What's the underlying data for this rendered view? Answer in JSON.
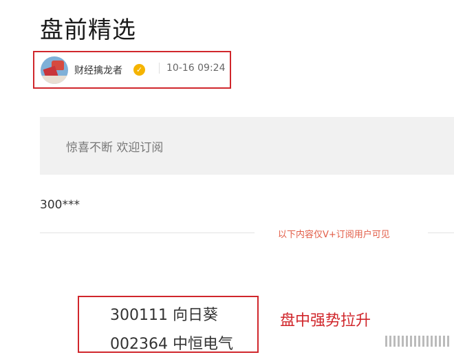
{
  "article": {
    "title": "盘前精选",
    "author": "财经擒龙者",
    "verified_icon": "check-badge-icon",
    "time": "10-16 09:24",
    "promo_text": "惊喜不断 欢迎订阅",
    "preview_code": "300***",
    "vip_notice": "以下内容仅V+订阅用户可见"
  },
  "stocks": [
    {
      "code": "300111",
      "name": "向日葵"
    },
    {
      "code": "002364",
      "name": "中恒电气"
    }
  ],
  "annotation": "盘中强势拉升",
  "colors": {
    "accent": "#d0262b",
    "vip_notice": "#e25b45",
    "badge": "#f5b400"
  }
}
